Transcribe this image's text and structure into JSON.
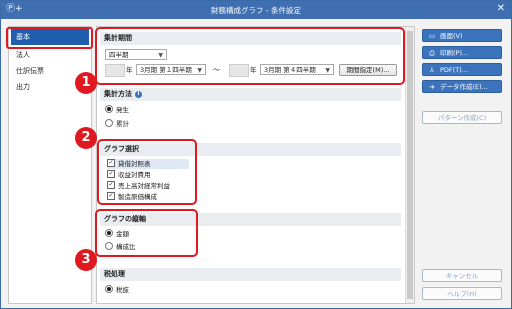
{
  "window": {
    "title": "財務構成グラフ - 条件設定",
    "close": "✕",
    "app_icon": "Ⓟ+"
  },
  "nav": {
    "items": [
      "基本",
      "法人",
      "仕訳伝票",
      "出力"
    ]
  },
  "period": {
    "header": "集計期間",
    "type_value": "四半期",
    "from_year": "年",
    "from_value": "3月期 第１四半期",
    "tilde": "〜",
    "to_year": "年",
    "to_value": "3月期 第４四半期",
    "button": "期間指定(M)..."
  },
  "method": {
    "header": "集計方法",
    "options": [
      "発生",
      "累計"
    ],
    "selected": 0
  },
  "graph": {
    "header": "グラフ選択",
    "items": [
      {
        "label": "貸借対照表",
        "checked": true
      },
      {
        "label": "収益対費用",
        "checked": true
      },
      {
        "label": "売上高対経常利益",
        "checked": true
      },
      {
        "label": "製造原価構成",
        "checked": true
      }
    ]
  },
  "axis": {
    "header": "グラフの縦軸",
    "options": [
      "金額",
      "構成比"
    ],
    "selected": 0
  },
  "tax": {
    "header": "税処理",
    "options": [
      "税抜"
    ],
    "selected": 0
  },
  "actions": {
    "screen": "画面(V)",
    "print": "印刷(P)...",
    "pdf": "PDF(T)...",
    "data": "データ作成(E)...",
    "pattern": "パターン作成(C)",
    "cancel": "キャンセル",
    "help": "ヘルプ(H)"
  },
  "annotations": [
    "1",
    "2",
    "3"
  ],
  "colors": {
    "accent": "#3b73bd",
    "annotation": "#e0181f",
    "title_bar": "#3f6fb0"
  }
}
